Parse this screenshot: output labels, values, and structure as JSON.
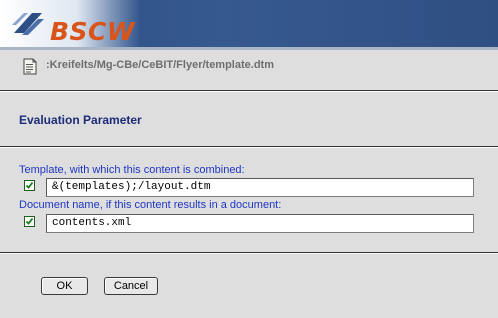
{
  "app": {
    "logo_text": "BSCW"
  },
  "location": {
    "path": ":Kreifelts/Mg-CBe/CeBIT/Flyer/template.dtm",
    "icon": "document-icon"
  },
  "form": {
    "section_title": "Evaluation Parameter",
    "template": {
      "label": "Template, with which this content is combined:",
      "value": "&(templates);/layout.dtm",
      "checked": true
    },
    "document_name": {
      "label": "Document name, if this content results in a document:",
      "value": "contents.xml",
      "checked": true
    }
  },
  "buttons": {
    "ok": "OK",
    "cancel": "Cancel"
  },
  "colors": {
    "banner": "#2f548b",
    "logo": "#d9541a",
    "label_blue": "#1f36c4",
    "title_navy": "#1d2b78",
    "background": "#dedede"
  }
}
